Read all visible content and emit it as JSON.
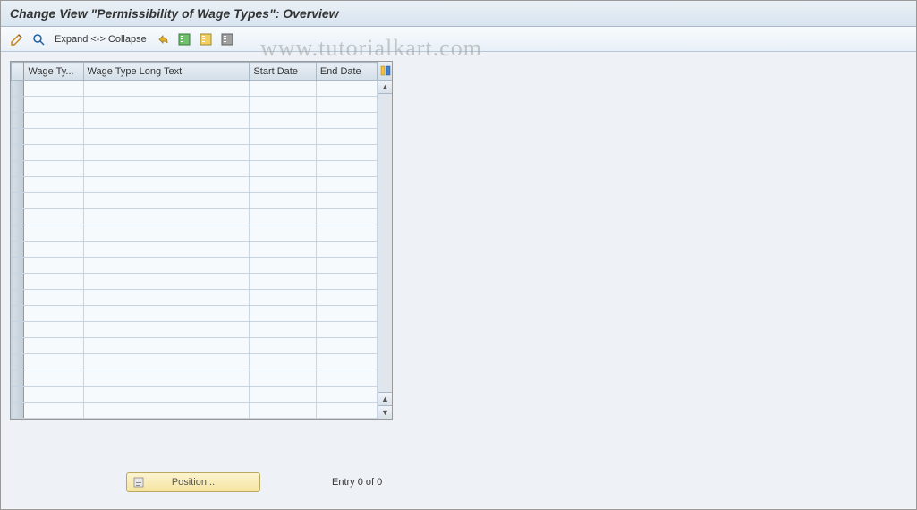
{
  "header": {
    "title": "Change View \"Permissibility of Wage Types\": Overview"
  },
  "toolbar": {
    "expand_label": "Expand <-> Collapse"
  },
  "grid": {
    "columns": {
      "wage_type": "Wage Ty...",
      "long_text": "Wage Type Long Text",
      "start_date": "Start Date",
      "end_date": "End Date"
    },
    "row_count": 21
  },
  "footer": {
    "position_label": "Position...",
    "entry_status": "Entry 0 of 0"
  },
  "watermark": "www.tutorialkart.com"
}
